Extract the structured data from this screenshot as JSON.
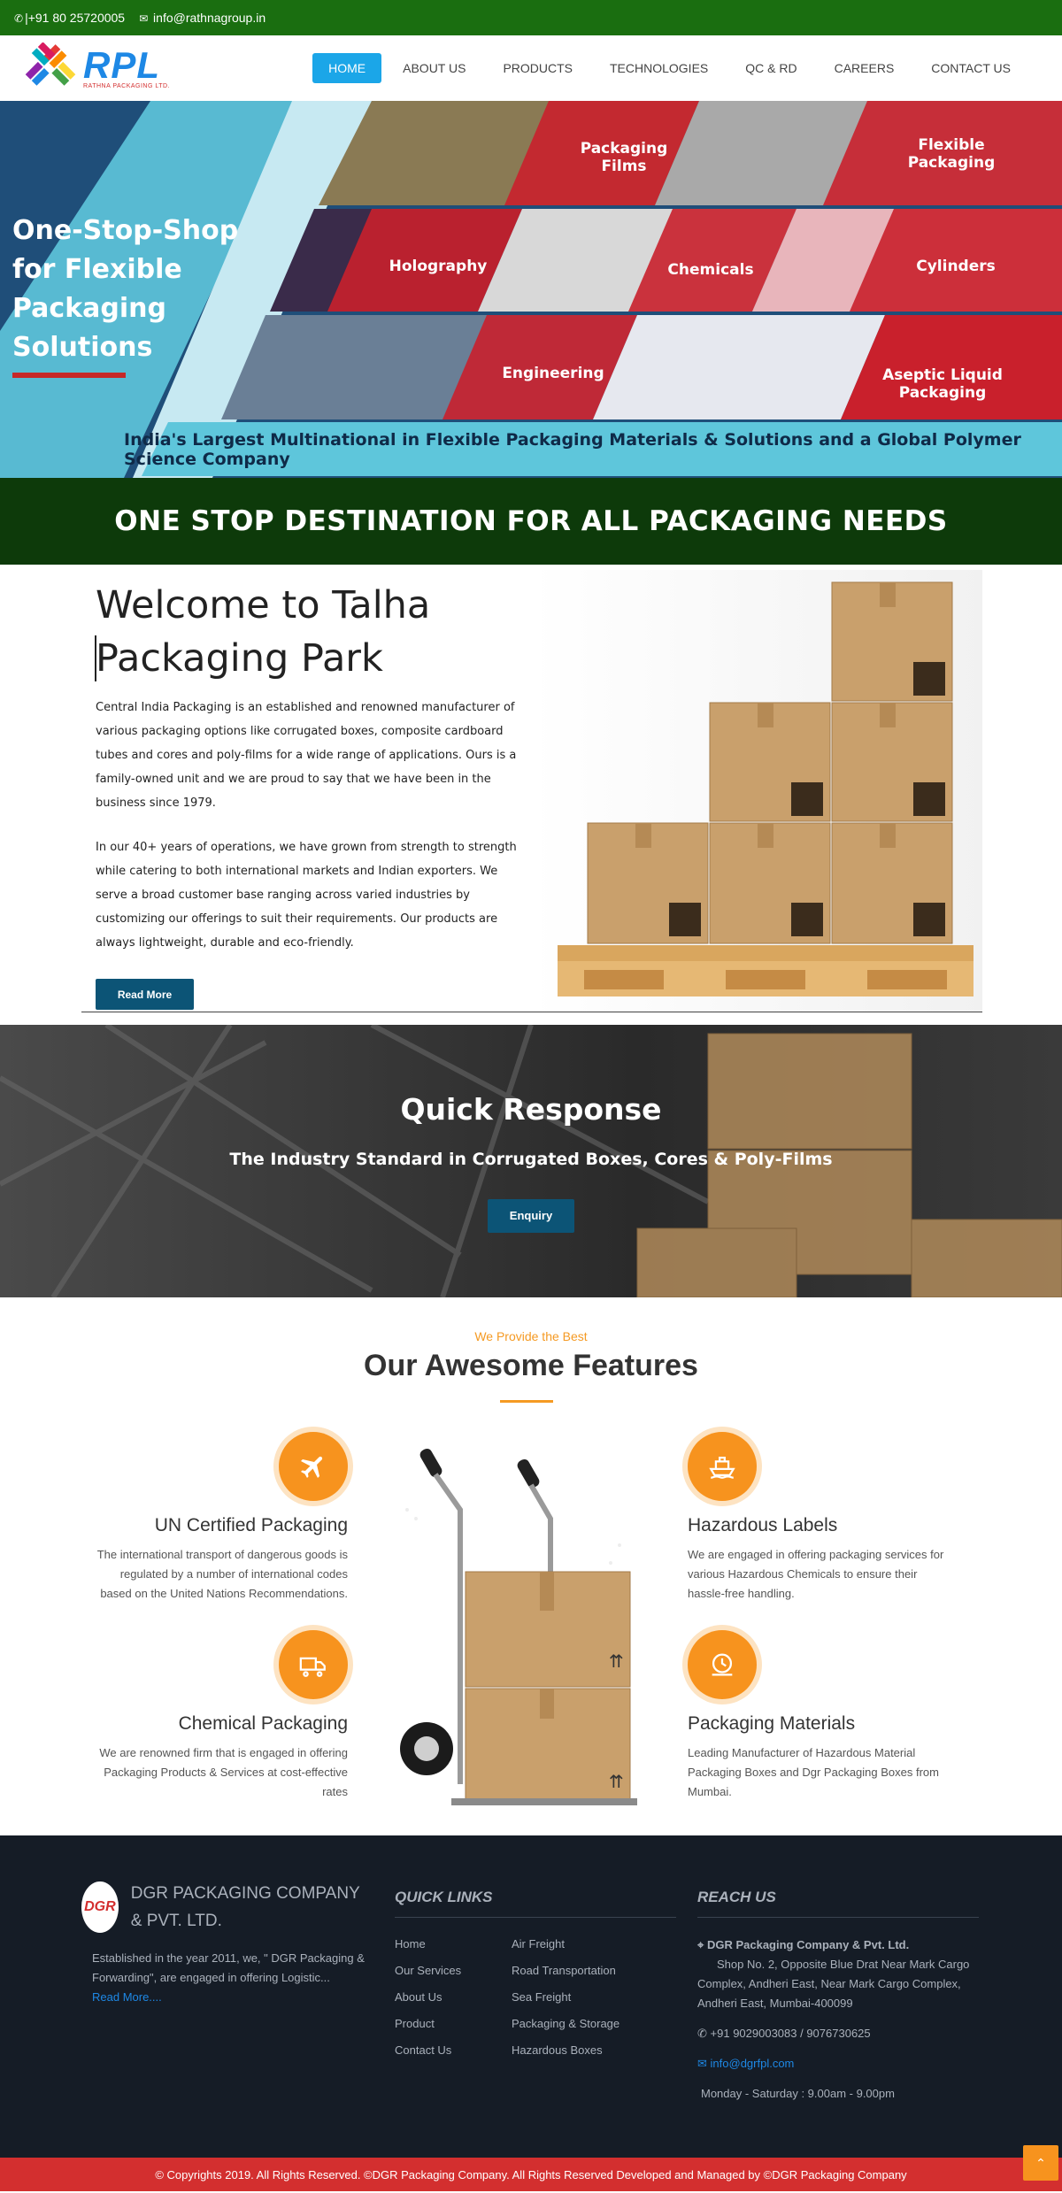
{
  "topbar": {
    "phone": "|+91 80 25720005",
    "email": "info@rathnagroup.in"
  },
  "header": {
    "logo_text": "RPL",
    "logo_subtext": "RATHNA PACKAGING LTD.",
    "nav": [
      "HOME",
      "ABOUT US",
      "PRODUCTS",
      "TECHNOLOGIES",
      "QC & RD",
      "CAREERS",
      "CONTACT US"
    ],
    "active_nav": "HOME"
  },
  "hero": {
    "headline": "One-Stop-Shop for Flexible Packaging Solutions",
    "tiles": [
      "Packaging Films",
      "Flexible Packaging",
      "Holography",
      "Chemicals",
      "Cylinders",
      "Engineering",
      "Aseptic Liquid Packaging"
    ],
    "tagline": "India's Largest Multinational in Flexible Packaging Materials & Solutions and a Global Polymer Science Company"
  },
  "banner": {
    "text": "ONE STOP DESTINATION FOR ALL PACKAGING NEEDS"
  },
  "welcome": {
    "title": "Welcome to Talha Packaging Park",
    "para1": "Central India Packaging is an established and renowned manufacturer of various packaging options like corrugated boxes, composite cardboard tubes and cores and poly-films for a wide range of applications. Ours is a family-owned unit and we are proud to say that we have been in the business since 1979.",
    "para2": "In our 40+ years of operations, we have grown from strength to strength while catering to both international markets and Indian exporters. We serve a broad customer base ranging across varied industries by customizing our offerings to suit their requirements. Our products are always lightweight, durable and eco-friendly.",
    "button": "Read More"
  },
  "quick": {
    "title": "Quick Response",
    "subtitle": "The Industry Standard in Corrugated Boxes, Cores & Poly-Films",
    "button": "Enquiry"
  },
  "features": {
    "eyebrow": "We Provide the Best",
    "title": "Our Awesome Features",
    "items": [
      {
        "title": "UN Certified Packaging",
        "text": "The international transport of dangerous goods is regulated by a number of international codes based on the United Nations Recommendations.",
        "icon": "airplane-icon"
      },
      {
        "title": "Hazardous Labels",
        "text": "We are engaged in offering packaging services for various Hazardous Chemicals to ensure their hassle-free handling.",
        "icon": "ship-icon"
      },
      {
        "title": "Chemical Packaging",
        "text": "We are renowned firm that is engaged in offering Packaging Products & Services at cost-effective rates",
        "icon": "truck-icon"
      },
      {
        "title": "Packaging Materials",
        "text": "Leading Manufacturer of Hazardous Material Packaging Boxes and Dgr Packaging Boxes from Mumbai.",
        "icon": "clock-truck-icon"
      }
    ]
  },
  "footer": {
    "brand_badge": "DGR",
    "brand_name": "DGR PACKAGING COMPANY & PVT. LTD.",
    "about": "Established in the year 2011, we, \" DGR Packaging & Forwarding\", are engaged in offering Logistic...",
    "about_more": "Read More....",
    "quick_links_title": "QUICK LINKS",
    "quick_links": [
      "Home",
      "Air Freight",
      "Our Services",
      "Road Transportation",
      "About Us",
      "Sea Freight",
      "Product",
      "Packaging & Storage",
      "Contact Us",
      "Hazardous Boxes"
    ],
    "reach_title": "REACH US",
    "company": "DGR Packaging Company & Pvt. Ltd.",
    "address": "Shop No. 2, Opposite Blue Drat Near Mark Cargo Complex, Andheri East, Near Mark Cargo Complex, Andheri East, Mumbai-400099",
    "phone": "+91 9029003083 / 9076730625",
    "email": "info@dgrfpl.com",
    "hours": "Monday - Saturday : 9.00am - 9.00pm",
    "copyright": "© Copyrights 2019. All Rights Reserved. ©DGR Packaging Company. All Rights Reserved Developed and Managed by ©DGR Packaging Company"
  },
  "colors": {
    "topbar": "#1a6e10",
    "nav_active": "#1ba6e8",
    "banner": "#0d3a0a",
    "accent": "#f7931e",
    "button": "#0c5476",
    "footer": "#151c26",
    "copyright_bar": "#d32f2f"
  }
}
